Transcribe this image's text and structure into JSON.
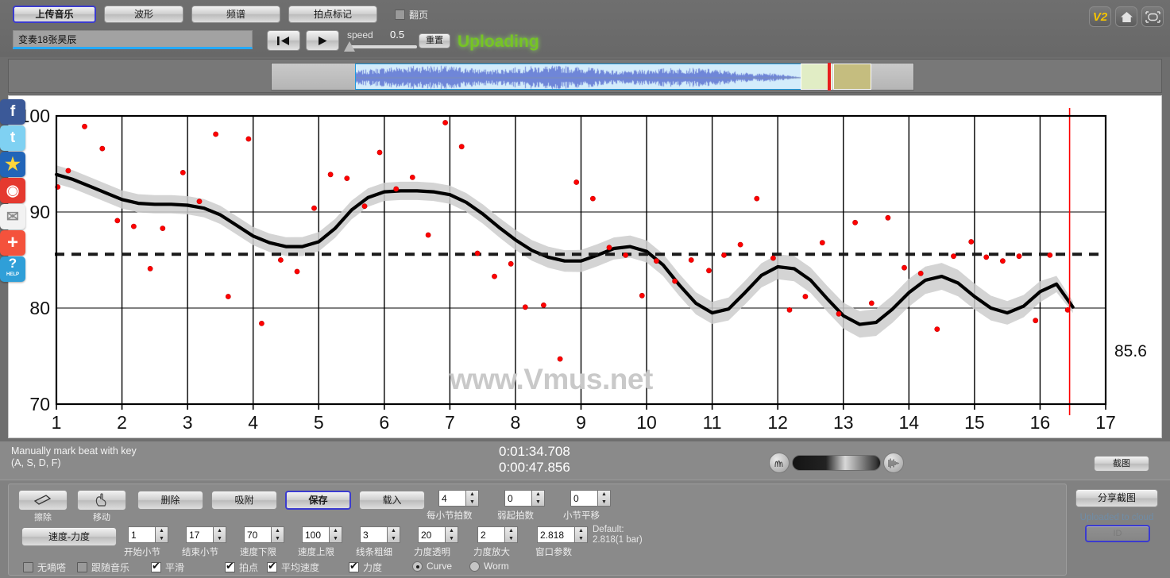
{
  "toolbar": {
    "tabs": [
      {
        "label": "上传音乐",
        "name": "tab-upload",
        "selected": true
      },
      {
        "label": "波形",
        "name": "tab-waveform",
        "selected": false
      },
      {
        "label": "频谱",
        "name": "tab-spectrum",
        "selected": false
      },
      {
        "label": "拍点标记",
        "name": "tab-beat-marking",
        "selected": false
      }
    ],
    "page_turn_checkbox": {
      "label": "翻页",
      "checked": false
    },
    "song_title": "变奏18张昊辰",
    "speed_label": "speed",
    "speed_value": "0.5",
    "reset_label": "重置",
    "status": "Uploading",
    "status_color": "#76c425",
    "version_badge": "V2"
  },
  "info": {
    "hint_line1": "Manually mark beat with key",
    "hint_line2": "(A, S, D, F)",
    "time_total": "0:01:34.708",
    "time_current": "0:00:47.856",
    "snapshot_label": "截图"
  },
  "social": [
    {
      "name": "facebook-share-icon",
      "glyph": "f"
    },
    {
      "name": "twitter-share-icon",
      "glyph": "t"
    },
    {
      "name": "qzone-share-icon",
      "glyph": "★"
    },
    {
      "name": "weibo-share-icon",
      "glyph": "◉"
    },
    {
      "name": "email-share-icon",
      "glyph": "✉"
    },
    {
      "name": "more-share-icon",
      "glyph": "+"
    },
    {
      "name": "help-icon",
      "glyph": "?",
      "sub": "HELP"
    }
  ],
  "controls": {
    "tool_buttons": [
      {
        "label": "擦除",
        "icon": "eraser-icon"
      },
      {
        "label": "移动",
        "icon": "hand-move-icon"
      }
    ],
    "action_buttons": [
      {
        "label": "删除",
        "name": "delete-button",
        "selected": false
      },
      {
        "label": "吸附",
        "name": "snap-button",
        "selected": false
      },
      {
        "label": "保存",
        "name": "save-button",
        "selected": true
      },
      {
        "label": "载入",
        "name": "load-button",
        "selected": false
      }
    ],
    "mode_button": "速度-力度",
    "spinners_row_top": [
      {
        "label": "每小节拍数",
        "value": "4",
        "name": "beats-per-bar"
      },
      {
        "label": "弱起拍数",
        "value": "0",
        "name": "pickup-beats"
      },
      {
        "label": "小节平移",
        "value": "0",
        "name": "bar-shift"
      }
    ],
    "spinners_row_bottom": [
      {
        "label": "开始小节",
        "value": "1",
        "name": "start-bar"
      },
      {
        "label": "结束小节",
        "value": "17",
        "name": "end-bar"
      },
      {
        "label": "速度下限",
        "value": "70",
        "name": "tempo-min"
      },
      {
        "label": "速度上限",
        "value": "100",
        "name": "tempo-max"
      },
      {
        "label": "线条粗细",
        "value": "3",
        "name": "line-width"
      },
      {
        "label": "力度透明",
        "value": "20",
        "name": "dynamics-alpha"
      },
      {
        "label": "力度放大",
        "value": "2",
        "name": "dynamics-scale"
      },
      {
        "label": "窗口参数",
        "value": "2.818",
        "name": "window-param"
      }
    ],
    "default_note_line1": "Default:",
    "default_note_line2": "2.818(1 bar)",
    "checkboxes": [
      {
        "label": "无嘀嗒",
        "checked": false,
        "name": "no-click-sound"
      },
      {
        "label": "跟随音乐",
        "checked": false,
        "name": "follow-music"
      },
      {
        "label": "平滑",
        "checked": true,
        "name": "smooth"
      },
      {
        "label": "拍点",
        "checked": true,
        "name": "beats"
      },
      {
        "label": "平均速度",
        "checked": true,
        "name": "average-tempo"
      },
      {
        "label": "力度",
        "checked": true,
        "name": "dynamics"
      }
    ],
    "radios": [
      {
        "label": "Curve",
        "checked": true,
        "name": "curve-mode"
      },
      {
        "label": "Worm",
        "checked": false,
        "name": "worm-mode"
      }
    ],
    "share_snapshot_label": "分享截图",
    "cloud_text": "Uploaded to cloud",
    "cloud_id": "ID"
  },
  "chart_data": {
    "type": "line",
    "title": "",
    "xlabel": "",
    "ylabel": "",
    "xlim": [
      1,
      17
    ],
    "ylim": [
      70,
      100
    ],
    "xticks": [
      1,
      2,
      3,
      4,
      5,
      6,
      7,
      8,
      9,
      10,
      11,
      12,
      13,
      14,
      15,
      16,
      17
    ],
    "yticks": [
      70,
      80,
      90,
      100
    ],
    "grid": "vertical-at-integers",
    "watermark": "www.Vmus.net",
    "mean_line": {
      "value": 85.6,
      "label": "85.6",
      "style": "dashed"
    },
    "playhead": {
      "x": 16.45,
      "color": "#ff0000"
    },
    "band_color": "#cccccc",
    "curve_color": "#000000",
    "point_color": "#ff0000",
    "series": [
      {
        "name": "smoothed tempo curve",
        "x": [
          1.0,
          1.25,
          1.5,
          1.75,
          2.0,
          2.25,
          2.5,
          2.75,
          3.0,
          3.25,
          3.5,
          3.75,
          4.0,
          4.25,
          4.5,
          4.75,
          5.0,
          5.25,
          5.5,
          5.75,
          6.0,
          6.25,
          6.5,
          6.75,
          7.0,
          7.25,
          7.5,
          7.75,
          8.0,
          8.25,
          8.5,
          8.75,
          9.0,
          9.25,
          9.5,
          9.75,
          10.0,
          10.25,
          10.5,
          10.75,
          11.0,
          11.25,
          11.5,
          11.75,
          12.0,
          12.25,
          12.5,
          12.75,
          13.0,
          13.25,
          13.5,
          13.75,
          14.0,
          14.25,
          14.5,
          14.75,
          15.0,
          15.25,
          15.5,
          15.75,
          16.0,
          16.25,
          16.5
        ],
        "y": [
          93.9,
          93.4,
          92.7,
          92.0,
          91.3,
          90.9,
          90.8,
          90.8,
          90.7,
          90.4,
          89.7,
          88.6,
          87.5,
          86.8,
          86.4,
          86.4,
          86.9,
          88.3,
          90.2,
          91.5,
          92.1,
          92.2,
          92.2,
          92.1,
          91.8,
          91.0,
          89.8,
          88.4,
          87.1,
          86.0,
          85.3,
          84.9,
          84.9,
          85.5,
          86.2,
          86.4,
          85.9,
          84.5,
          82.4,
          80.5,
          79.5,
          79.9,
          81.6,
          83.4,
          84.3,
          84.1,
          82.9,
          81.0,
          79.2,
          78.3,
          78.5,
          79.9,
          81.6,
          82.9,
          83.3,
          82.6,
          81.2,
          80.0,
          79.5,
          80.2,
          81.7,
          82.5,
          80.1
        ]
      },
      {
        "name": "confidence band half-width",
        "x": [
          1.0,
          2.0,
          3.0,
          4.0,
          5.0,
          6.0,
          7.0,
          8.0,
          9.0,
          10.0,
          11.0,
          12.0,
          13.0,
          14.0,
          15.0,
          16.0,
          16.5
        ],
        "y": [
          0.95,
          0.95,
          0.95,
          0.95,
          1.0,
          0.95,
          0.95,
          1.05,
          1.15,
          1.15,
          1.15,
          1.3,
          1.35,
          1.45,
          1.35,
          1.1,
          0.6
        ]
      }
    ],
    "points": {
      "name": "per-beat tempo",
      "x": [
        1.02,
        1.18,
        1.43,
        1.7,
        1.93,
        2.18,
        2.43,
        2.62,
        2.93,
        3.18,
        3.43,
        3.62,
        3.93,
        4.13,
        4.42,
        4.67,
        4.93,
        5.18,
        5.43,
        5.7,
        5.93,
        6.18,
        6.43,
        6.67,
        6.93,
        7.18,
        7.42,
        7.68,
        7.93,
        8.15,
        8.43,
        8.68,
        8.93,
        9.18,
        9.43,
        9.68,
        9.93,
        10.15,
        10.43,
        10.68,
        10.95,
        11.18,
        11.43,
        11.68,
        11.93,
        12.18,
        12.42,
        12.68,
        12.93,
        13.18,
        13.43,
        13.68,
        13.93,
        14.18,
        14.43,
        14.68,
        14.95,
        15.18,
        15.43,
        15.68,
        15.93,
        16.15,
        16.42
      ],
      "y": [
        92.6,
        94.3,
        98.9,
        96.6,
        89.1,
        88.5,
        84.1,
        88.3,
        94.1,
        91.1,
        98.1,
        81.2,
        97.6,
        78.4,
        85.0,
        83.8,
        90.4,
        93.9,
        93.5,
        90.6,
        96.2,
        92.4,
        93.6,
        87.6,
        99.3,
        96.8,
        85.7,
        83.3,
        84.6,
        80.1,
        80.3,
        74.7,
        93.1,
        91.4,
        86.3,
        85.5,
        81.3,
        84.9,
        82.8,
        85.0,
        83.9,
        85.5,
        86.6,
        91.4,
        85.2,
        79.8,
        81.2,
        86.8,
        79.4,
        88.9,
        80.5,
        89.4,
        84.2,
        83.6,
        77.8,
        85.4,
        86.9,
        85.3,
        84.9,
        85.4,
        78.7,
        85.5,
        79.8
      ]
    }
  }
}
